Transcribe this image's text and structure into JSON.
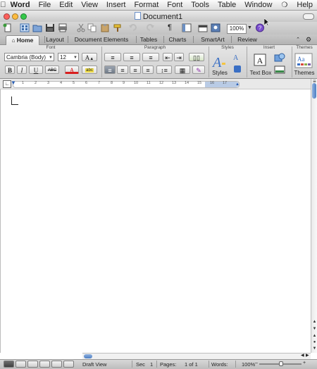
{
  "menubar": {
    "apple_icon": "apple-icon",
    "items": [
      "Word",
      "File",
      "Edit",
      "View",
      "Insert",
      "Format",
      "Font",
      "Tools",
      "Table",
      "Window",
      "Help"
    ],
    "script_icon": "script-menu-icon"
  },
  "window": {
    "title": "Document1",
    "colors": {
      "close": "#fc605b",
      "minimize": "#fdbc40",
      "zoom": "#34c84a"
    }
  },
  "toolbar": {
    "icons": [
      "new-icon",
      "templates-icon",
      "open-icon",
      "save-icon",
      "print-icon",
      "cut-icon",
      "copy-icon",
      "paste-icon",
      "format-painter-icon",
      "undo-icon",
      "redo-icon",
      "paragraph-marks-icon",
      "sidebar-icon",
      "toolbox-icon",
      "media-icon",
      "help-icon"
    ],
    "zoom": "100%"
  },
  "ribbon_tabs": {
    "items": [
      "Home",
      "Layout",
      "Document Elements",
      "Tables",
      "Charts",
      "SmartArt",
      "Review"
    ],
    "active": "Home"
  },
  "ribbon": {
    "groups": {
      "font": "Font",
      "paragraph": "Paragraph",
      "styles": "Styles",
      "insert": "Insert",
      "themes": "Themes"
    },
    "font_name": "Cambria (Body)",
    "font_size": "12",
    "bold": "B",
    "italic": "I",
    "underline": "U",
    "strikethrough": "ABC",
    "grow_font": "A",
    "font_color": "A",
    "styles_label": "Styles",
    "text_box_label": "Text Box",
    "themes_label": "Themes"
  },
  "ruler": {
    "numbers": [
      "1",
      "2",
      "3",
      "4",
      "5",
      "6",
      "7",
      "8",
      "9",
      "10",
      "11",
      "12",
      "13",
      "14",
      "15",
      "16",
      "17"
    ]
  },
  "statusbar": {
    "view_mode": "Draft View",
    "sec_label": "Sec",
    "sec_value": "1",
    "pages_label": "Pages:",
    "pages_value": "1 of 1",
    "words_label": "Words:",
    "zoom": "100%"
  }
}
